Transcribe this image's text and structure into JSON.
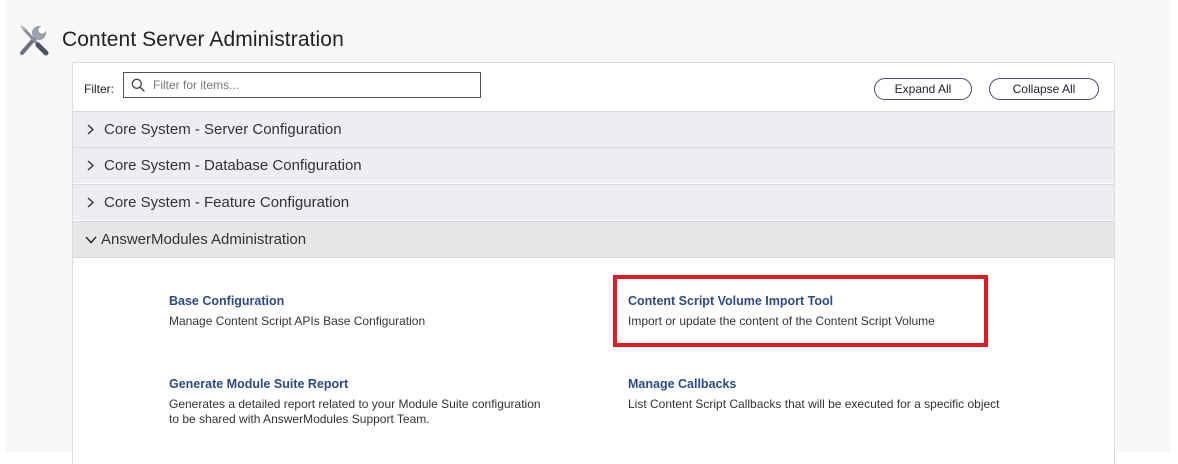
{
  "header": {
    "title": "Content Server Administration",
    "icon": "tools-icon"
  },
  "filter": {
    "label": "Filter:",
    "placeholder": "Filter for items...",
    "value": ""
  },
  "buttons": {
    "expand_all": "Expand All",
    "collapse_all": "Collapse All"
  },
  "sections": [
    {
      "label": "Core System - Server Configuration",
      "expanded": false
    },
    {
      "label": "Core System - Database Configuration",
      "expanded": false
    },
    {
      "label": "Core System - Feature Configuration",
      "expanded": false
    },
    {
      "label": "AnswerModules Administration",
      "expanded": true
    }
  ],
  "items": [
    {
      "title": "Base Configuration",
      "description": "Manage Content Script APIs Base Configuration"
    },
    {
      "title": "Content Script Volume Import Tool",
      "description": "Import or update the content of the Content Script Volume",
      "highlighted": true
    },
    {
      "title": "Generate Module Suite Report",
      "description": "Generates a detailed report related to your Module Suite configuration to be shared with AnswerModules Support Team."
    },
    {
      "title": "Manage Callbacks",
      "description": "List Content Script Callbacks that will be executed for a specific object"
    }
  ],
  "colors": {
    "link": "#2c4a86",
    "highlight": "#e01b24",
    "section_bg": "#eceef2"
  }
}
